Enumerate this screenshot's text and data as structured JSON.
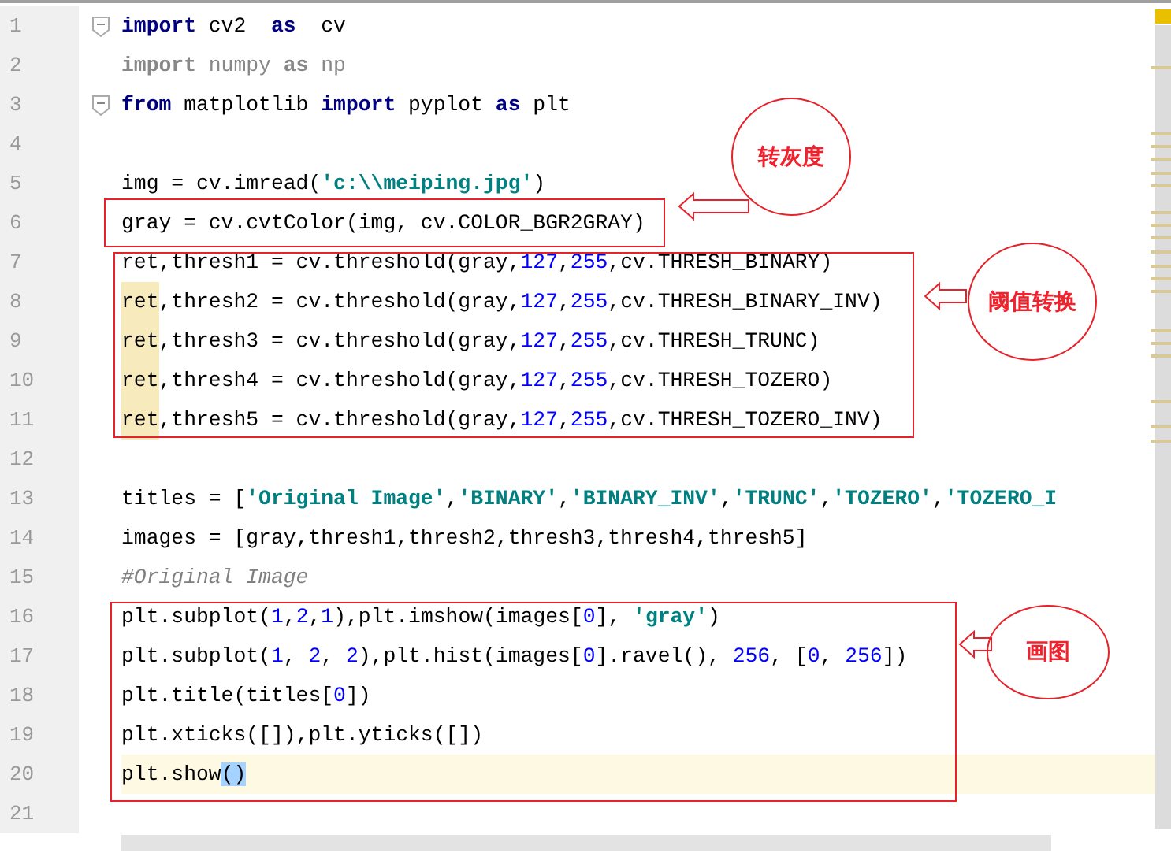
{
  "editor": {
    "lines": [
      {
        "number": "1",
        "fold": true,
        "current": false,
        "tokens": [
          {
            "kind": "keyword",
            "text": "import"
          },
          {
            "kind": "plain",
            "text": " cv2  "
          },
          {
            "kind": "keyword",
            "text": "as"
          },
          {
            "kind": "plain",
            "text": "  cv"
          }
        ]
      },
      {
        "number": "2",
        "fold": false,
        "current": false,
        "tokens": [
          {
            "kind": "unused_keyword",
            "text": "import"
          },
          {
            "kind": "unused",
            "text": " numpy "
          },
          {
            "kind": "unused_keyword",
            "text": "as"
          },
          {
            "kind": "unused",
            "text": " np"
          }
        ]
      },
      {
        "number": "3",
        "fold": true,
        "current": false,
        "tokens": [
          {
            "kind": "keyword",
            "text": "from"
          },
          {
            "kind": "plain",
            "text": " matplotlib "
          },
          {
            "kind": "keyword",
            "text": "import"
          },
          {
            "kind": "plain",
            "text": " pyplot "
          },
          {
            "kind": "keyword",
            "text": "as"
          },
          {
            "kind": "plain",
            "text": " plt"
          }
        ]
      },
      {
        "number": "4",
        "fold": false,
        "current": false
      },
      {
        "number": "5",
        "fold": false,
        "current": false,
        "tokens": [
          {
            "kind": "plain",
            "text": "img = cv.imread("
          },
          {
            "kind": "string",
            "text": "'c:\\\\meiping.jpg'"
          },
          {
            "kind": "plain",
            "text": ")"
          }
        ]
      },
      {
        "number": "6",
        "fold": false,
        "current": false,
        "tokens": [
          {
            "kind": "plain",
            "text": "gray = cv.cvtColor(img, cv.COLOR_BGR2GRAY)"
          }
        ]
      },
      {
        "number": "7",
        "fold": false,
        "current": false,
        "tokens": [
          {
            "kind": "plain",
            "text": "ret,thresh1 = cv.threshold(gray,"
          },
          {
            "kind": "number",
            "text": "127"
          },
          {
            "kind": "plain",
            "text": ","
          },
          {
            "kind": "number",
            "text": "255"
          },
          {
            "kind": "plain",
            "text": ",cv.THRESH_BINARY)"
          }
        ]
      },
      {
        "number": "8",
        "fold": false,
        "current": false,
        "tokens": [
          {
            "kind": "match",
            "text": "ret"
          },
          {
            "kind": "plain",
            "text": ",thresh2 = cv.threshold(gray,"
          },
          {
            "kind": "number",
            "text": "127"
          },
          {
            "kind": "plain",
            "text": ","
          },
          {
            "kind": "number",
            "text": "255"
          },
          {
            "kind": "plain",
            "text": ",cv.THRESH_BINARY_INV)"
          }
        ]
      },
      {
        "number": "9",
        "fold": false,
        "current": false,
        "tokens": [
          {
            "kind": "match",
            "text": "ret"
          },
          {
            "kind": "plain",
            "text": ",thresh3 = cv.threshold(gray,"
          },
          {
            "kind": "number",
            "text": "127"
          },
          {
            "kind": "plain",
            "text": ","
          },
          {
            "kind": "number",
            "text": "255"
          },
          {
            "kind": "plain",
            "text": ",cv.THRESH_TRUNC)"
          }
        ]
      },
      {
        "number": "10",
        "fold": false,
        "current": false,
        "tokens": [
          {
            "kind": "match",
            "text": "ret"
          },
          {
            "kind": "plain",
            "text": ",thresh4 = cv.threshold(gray,"
          },
          {
            "kind": "number",
            "text": "127"
          },
          {
            "kind": "plain",
            "text": ","
          },
          {
            "kind": "number",
            "text": "255"
          },
          {
            "kind": "plain",
            "text": ",cv.THRESH_TOZERO)"
          }
        ]
      },
      {
        "number": "11",
        "fold": false,
        "current": false,
        "tokens": [
          {
            "kind": "match",
            "text": "ret"
          },
          {
            "kind": "plain",
            "text": ",thresh5 = cv.threshold(gray,"
          },
          {
            "kind": "number",
            "text": "127"
          },
          {
            "kind": "plain",
            "text": ","
          },
          {
            "kind": "number",
            "text": "255"
          },
          {
            "kind": "plain",
            "text": ",cv.THRESH_TOZERO_INV)"
          }
        ]
      },
      {
        "number": "12",
        "fold": false,
        "current": false
      },
      {
        "number": "13",
        "fold": false,
        "current": false,
        "tokens": [
          {
            "kind": "plain",
            "text": "titles = ["
          },
          {
            "kind": "string",
            "text": "'Original Image'"
          },
          {
            "kind": "plain",
            "text": ","
          },
          {
            "kind": "string",
            "text": "'BINARY'"
          },
          {
            "kind": "plain",
            "text": ","
          },
          {
            "kind": "string",
            "text": "'BINARY_INV'"
          },
          {
            "kind": "plain",
            "text": ","
          },
          {
            "kind": "string",
            "text": "'TRUNC'"
          },
          {
            "kind": "plain",
            "text": ","
          },
          {
            "kind": "string",
            "text": "'TOZERO'"
          },
          {
            "kind": "plain",
            "text": ","
          },
          {
            "kind": "string",
            "text": "'TOZERO_I"
          }
        ]
      },
      {
        "number": "14",
        "fold": false,
        "current": false,
        "tokens": [
          {
            "kind": "plain",
            "text": "images = [gray,thresh1,thresh2,thresh3,thresh4,thresh5]"
          }
        ]
      },
      {
        "number": "15",
        "fold": false,
        "current": false,
        "tokens": [
          {
            "kind": "comment",
            "text": "#Original Image"
          }
        ]
      },
      {
        "number": "16",
        "fold": false,
        "current": false,
        "tokens": [
          {
            "kind": "plain",
            "text": "plt.subplot("
          },
          {
            "kind": "number",
            "text": "1"
          },
          {
            "kind": "plain",
            "text": ","
          },
          {
            "kind": "number",
            "text": "2"
          },
          {
            "kind": "plain",
            "text": ","
          },
          {
            "kind": "number",
            "text": "1"
          },
          {
            "kind": "plain",
            "text": "),plt.imshow(images["
          },
          {
            "kind": "number",
            "text": "0"
          },
          {
            "kind": "plain",
            "text": "], "
          },
          {
            "kind": "string",
            "text": "'gray'"
          },
          {
            "kind": "plain",
            "text": ")"
          }
        ]
      },
      {
        "number": "17",
        "fold": false,
        "current": false,
        "tokens": [
          {
            "kind": "plain",
            "text": "plt.subplot("
          },
          {
            "kind": "number",
            "text": "1"
          },
          {
            "kind": "plain",
            "text": ", "
          },
          {
            "kind": "number",
            "text": "2"
          },
          {
            "kind": "plain",
            "text": ", "
          },
          {
            "kind": "number",
            "text": "2"
          },
          {
            "kind": "plain",
            "text": "),plt.hist(images["
          },
          {
            "kind": "number",
            "text": "0"
          },
          {
            "kind": "plain",
            "text": "].ravel(), "
          },
          {
            "kind": "number",
            "text": "256"
          },
          {
            "kind": "plain",
            "text": ", ["
          },
          {
            "kind": "number",
            "text": "0"
          },
          {
            "kind": "plain",
            "text": ", "
          },
          {
            "kind": "number",
            "text": "256"
          },
          {
            "kind": "plain",
            "text": "])"
          }
        ]
      },
      {
        "number": "18",
        "fold": false,
        "current": false,
        "tokens": [
          {
            "kind": "plain",
            "text": "plt.title(titles["
          },
          {
            "kind": "number",
            "text": "0"
          },
          {
            "kind": "plain",
            "text": "])"
          }
        ]
      },
      {
        "number": "19",
        "fold": false,
        "current": false,
        "tokens": [
          {
            "kind": "plain",
            "text": "plt.xticks([]),plt.yticks([])"
          }
        ]
      },
      {
        "number": "20",
        "fold": false,
        "current": true,
        "tokens": [
          {
            "kind": "plain",
            "text": "plt.show"
          },
          {
            "kind": "selected",
            "text": "()"
          }
        ]
      },
      {
        "number": "21",
        "fold": false,
        "current": false
      }
    ]
  },
  "annotations": [
    {
      "label": "转灰度"
    },
    {
      "label": "阈值转换"
    },
    {
      "label": "画图"
    }
  ]
}
